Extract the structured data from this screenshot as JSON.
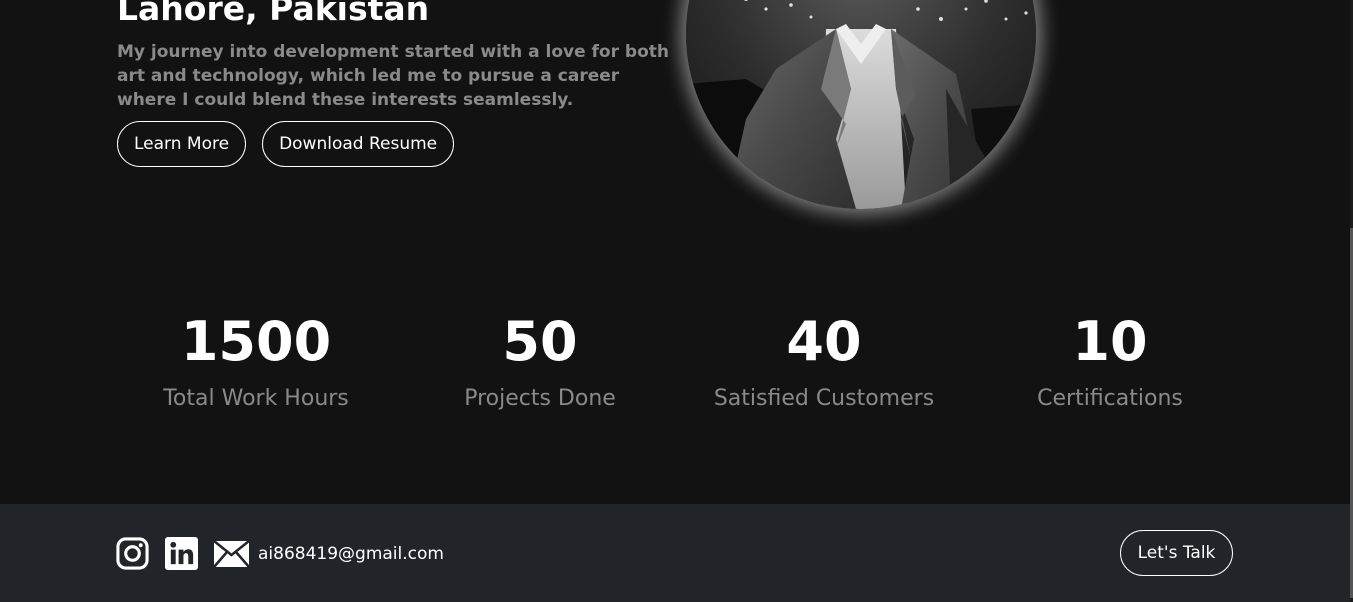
{
  "hero": {
    "title": "Lahore, Pakistan",
    "description": "My journey into development started with a love for both art and technology, which led me to pursue a career where I could blend these interests seamlessly.",
    "learn_more_label": "Learn More",
    "download_resume_label": "Download Resume",
    "photo_alt": "Profile photo"
  },
  "stats": [
    {
      "value": "1500",
      "label": "Total Work Hours"
    },
    {
      "value": "50",
      "label": "Projects Done"
    },
    {
      "value": "40",
      "label": "Satisfied Customers"
    },
    {
      "value": "10",
      "label": "Certifications"
    }
  ],
  "footer": {
    "icons": [
      "instagram-icon",
      "linkedin-icon",
      "mail-icon"
    ],
    "email": "ai868419@gmail.com",
    "lets_talk_label": "Let's Talk"
  },
  "colors": {
    "background": "#121212",
    "footer_background": "#212429",
    "muted_text": "#8a8a8a",
    "text": "#ffffff"
  }
}
